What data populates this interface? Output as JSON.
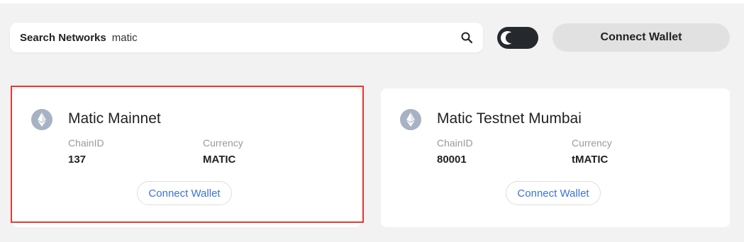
{
  "search": {
    "label": "Search Networks",
    "value": "matic",
    "icon": "search-icon"
  },
  "theme_toggle": {
    "icon": "moon-icon"
  },
  "header": {
    "connect_wallet_label": "Connect Wallet"
  },
  "networks": [
    {
      "name": "Matic Mainnet",
      "chain_id_label": "ChainID",
      "chain_id": "137",
      "currency_label": "Currency",
      "currency": "MATIC",
      "button_label": "Connect Wallet",
      "icon": "ethereum-icon",
      "selected": true
    },
    {
      "name": "Matic Testnet Mumbai",
      "chain_id_label": "ChainID",
      "chain_id": "80001",
      "currency_label": "Currency",
      "currency": "tMATIC",
      "button_label": "Connect Wallet",
      "icon": "ethereum-icon",
      "selected": false
    }
  ],
  "colors": {
    "highlight_border": "#e53935",
    "link_blue": "#3b73d9",
    "toggle_bg": "#25282c"
  }
}
